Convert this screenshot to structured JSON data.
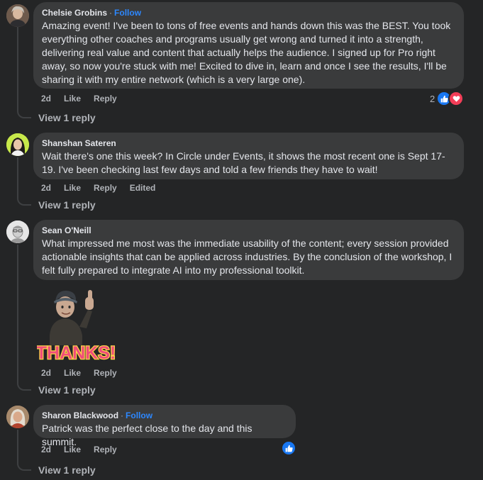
{
  "comments": [
    {
      "author": "Chelsie Grobins",
      "follow": "Follow",
      "text": "Amazing event! I've been to tons of free events and hands down this was the BEST. You took everything other coaches and programs usually get wrong and turned it into a strength, delivering real value and content that actually helps the audience. I signed up for Pro right away, so now you're stuck with me! Excited to dive in, learn and once I see the results, I'll be sharing it with my entire network (which is a very large one).",
      "time": "2d",
      "like": "Like",
      "reply": "Reply",
      "reaction_count": "2",
      "view_replies": "View 1 reply"
    },
    {
      "author": "Shanshan Sateren",
      "text": "Wait there's one this week? In Circle under Events, it shows the most recent one is Sept 17-19. I've been checking last few days and told a few friends they have to wait!",
      "time": "2d",
      "like": "Like",
      "reply": "Reply",
      "edited": "Edited",
      "view_replies": "View 1 reply"
    },
    {
      "author": "Sean O'Neill",
      "text": "What impressed me most was the immediate usability of the content; every session provided actionable insights that can be applied across industries. By the conclusion of the workshop, I felt fully prepared to integrate AI into my professional toolkit.",
      "sticker_text": "THANKS!",
      "time": "2d",
      "like": "Like",
      "reply": "Reply",
      "view_replies": "View 1 reply"
    },
    {
      "author": "Sharon Blackwood",
      "follow": "Follow",
      "text": "Patrick was the perfect close to the day and this summit.",
      "time": "2d",
      "like": "Like",
      "reply": "Reply",
      "view_replies": "View 1 reply"
    }
  ],
  "icons": {
    "like": "like-reaction-icon",
    "love": "love-reaction-icon"
  },
  "colors": {
    "background": "#242526",
    "bubble": "#3a3b3c",
    "accent": "#2d88ff",
    "like": "#1877f2",
    "love": "#f33e58"
  }
}
